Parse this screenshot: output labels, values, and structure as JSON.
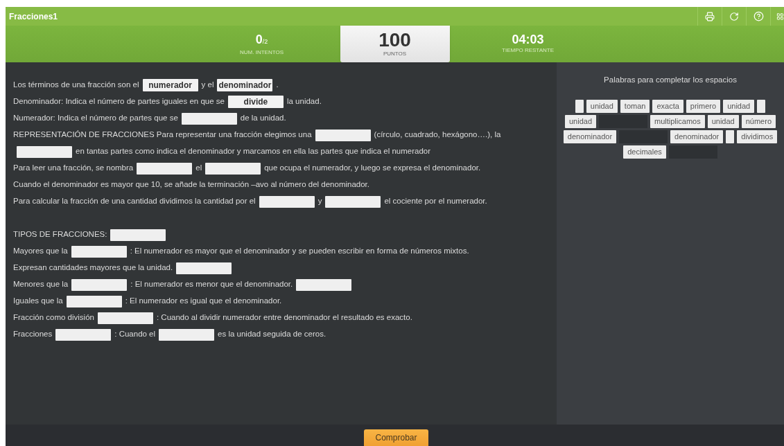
{
  "window": {
    "title": "Fracciones1"
  },
  "stats": {
    "attempts": "0",
    "attempts_total": "/2",
    "attempts_label": "NUM. INTENTOS",
    "points": "100",
    "points_label": "PUNTOS",
    "time": "04:03",
    "time_label": "TIEMPO RESTANTE"
  },
  "sections": [
    {
      "lines": [
        [
          {
            "kind": "text",
            "text": "Los términos de una fracción son el"
          },
          {
            "kind": "blank",
            "value": "numerador"
          },
          {
            "kind": "text",
            "text": "y el"
          },
          {
            "kind": "blank",
            "value": "denominador"
          },
          {
            "kind": "text",
            "text": "."
          }
        ],
        [
          {
            "kind": "text",
            "text": "Denominador: Indica el número de partes iguales en que se"
          },
          {
            "kind": "blank",
            "value": "divide"
          },
          {
            "kind": "text",
            "text": "la unidad."
          }
        ],
        [
          {
            "kind": "text",
            "text": "Numerador: Indica el número de partes que se"
          },
          {
            "kind": "blank"
          },
          {
            "kind": "text",
            "text": "de la unidad."
          }
        ],
        [
          {
            "kind": "text",
            "text": "REPRESENTACIÓN DE FRACCIONES Para representar una fracción elegimos una"
          },
          {
            "kind": "blank"
          },
          {
            "kind": "text",
            "text": "(círculo, cuadrado, hexágono….), la"
          }
        ],
        [
          {
            "kind": "blank"
          },
          {
            "kind": "text",
            "text": "en tantas partes como indica el denominador y marcamos en ella las partes que indica el numerador"
          }
        ],
        [
          {
            "kind": "text",
            "text": "Para leer una fracción, se nombra"
          },
          {
            "kind": "blank"
          },
          {
            "kind": "text",
            "text": "el"
          },
          {
            "kind": "blank"
          },
          {
            "kind": "text",
            "text": "que ocupa el numerador, y luego se expresa el denominador."
          }
        ],
        [
          {
            "kind": "text",
            "text": "Cuando el denominador es mayor que 10, se añade la terminación –avo al número del denominador."
          }
        ],
        [
          {
            "kind": "text",
            "text": "Para calcular la fracción de una cantidad dividimos la cantidad por el"
          },
          {
            "kind": "blank"
          },
          {
            "kind": "text",
            "text": "y"
          },
          {
            "kind": "blank"
          },
          {
            "kind": "text",
            "text": "el cociente por el numerador."
          }
        ]
      ]
    },
    {
      "lines": [
        [
          {
            "kind": "text",
            "text": "TIPOS DE FRACCIONES:"
          },
          {
            "kind": "blank"
          }
        ],
        [
          {
            "kind": "text",
            "text": "Mayores que la"
          },
          {
            "kind": "blank"
          },
          {
            "kind": "text",
            "text": ": El numerador es mayor que el denominador y se pueden escribir en forma de números mixtos."
          }
        ],
        [
          {
            "kind": "text",
            "text": "Expresan cantidades mayores que la unidad."
          },
          {
            "kind": "blank"
          }
        ],
        [
          {
            "kind": "text",
            "text": "Menores que la"
          },
          {
            "kind": "blank"
          },
          {
            "kind": "text",
            "text": ": El numerador es menor que el denominador."
          },
          {
            "kind": "blank"
          }
        ],
        [
          {
            "kind": "text",
            "text": "Iguales que la"
          },
          {
            "kind": "blank"
          },
          {
            "kind": "text",
            "text": ": El numerador es igual que el denominador."
          }
        ],
        [
          {
            "kind": "text",
            "text": "Fracción como división"
          },
          {
            "kind": "blank"
          },
          {
            "kind": "text",
            "text": ": Cuando al dividir numerador entre denominador el resultado es exacto."
          }
        ],
        [
          {
            "kind": "text",
            "text": "Fracciones"
          },
          {
            "kind": "blank"
          },
          {
            "kind": "text",
            "text": ": Cuando el"
          },
          {
            "kind": "blank"
          },
          {
            "kind": "text",
            "text": "es la unidad seguida de ceros."
          }
        ]
      ]
    }
  ],
  "word_bank": {
    "title": "Palabras para completar los espacios",
    "chips": [
      {
        "kind": "used"
      },
      {
        "kind": "word",
        "text": "unidad"
      },
      {
        "kind": "word",
        "text": "toman"
      },
      {
        "kind": "word",
        "text": "exacta"
      },
      {
        "kind": "word",
        "text": "primero"
      },
      {
        "kind": "word",
        "text": "unidad"
      },
      {
        "kind": "used"
      },
      {
        "kind": "word",
        "text": "unidad"
      },
      {
        "kind": "slot"
      },
      {
        "kind": "word",
        "text": "multiplicamos"
      },
      {
        "kind": "word",
        "text": "unidad"
      },
      {
        "kind": "word",
        "text": "número"
      },
      {
        "kind": "word",
        "text": "denominador"
      },
      {
        "kind": "slot"
      },
      {
        "kind": "word",
        "text": "denominador"
      },
      {
        "kind": "used"
      },
      {
        "kind": "word",
        "text": "dividimos"
      },
      {
        "kind": "word",
        "text": "decimales"
      },
      {
        "kind": "slot"
      }
    ]
  },
  "check_button": "Comprobar"
}
